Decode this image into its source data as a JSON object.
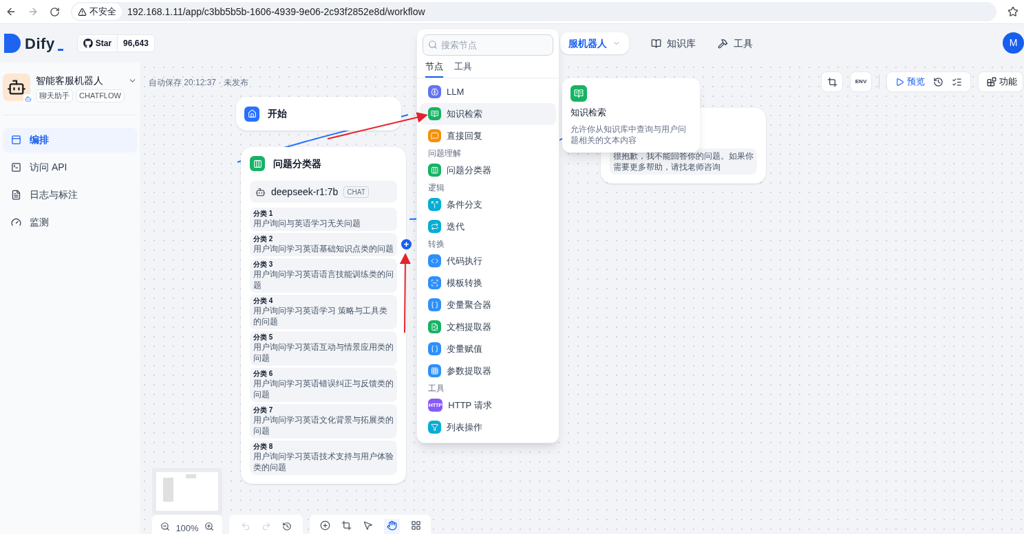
{
  "browser": {
    "security": "不安全",
    "url": "192.168.1.11/app/c3bb5b5b-1606-4939-9e06-2c93f2852e8d/workflow"
  },
  "header": {
    "brand": "Dify",
    "github": "Star",
    "star_count": "96,643",
    "nav": [
      {
        "label": "服机器人",
        "selected": true
      },
      {
        "label": "知识库",
        "selected": false
      },
      {
        "label": "工具",
        "selected": false
      }
    ],
    "avatar": "M"
  },
  "sidebar": {
    "app_name": "智能客服机器人",
    "tags": [
      "聊天助手",
      "CHATFLOW"
    ],
    "items": [
      {
        "label": "编排",
        "selected": true
      },
      {
        "label": "访问 API",
        "selected": false
      },
      {
        "label": "日志与标注",
        "selected": false
      },
      {
        "label": "监测",
        "selected": false
      }
    ]
  },
  "canvas": {
    "autosave": "自动保存 20:12:37 · 未发布",
    "start_node": {
      "title": "开始"
    },
    "classifier_node": {
      "title": "问题分类器",
      "model": "deepseek-r1:7b",
      "model_tag": "CHAT",
      "classes": [
        {
          "label": "分类 1",
          "text": "用户询问与英语学习无关问题"
        },
        {
          "label": "分类 2",
          "text": "用户询问学习英语基础知识点类的问题"
        },
        {
          "label": "分类 3",
          "text": "用户询问学习英语语言技能训练类的问题"
        },
        {
          "label": "分类 4",
          "text": "用户询问学习英语学习 策略与工具类的问题"
        },
        {
          "label": "分类 5",
          "text": "用户询问学习英语互动与情景应用类的问题"
        },
        {
          "label": "分类 6",
          "text": "用户询问学习英语错误纠正与反馈类的问题"
        },
        {
          "label": "分类 7",
          "text": "用户询问学习英语文化背景与拓展类的问题"
        },
        {
          "label": "分类 8",
          "text": "用户询问学习英语技术支持与用户体验类的问题"
        }
      ]
    },
    "answer_node": {
      "text": "很抱歉，我不能回答你的问题。如果你需要更多帮助，请找老师咨询"
    },
    "toolbar": {
      "env": "ENV",
      "preview": "预览",
      "features": "功能"
    },
    "zoom": "100%"
  },
  "node_picker": {
    "placeholder": "搜索节点",
    "tabs": [
      {
        "label": "节点",
        "selected": true
      },
      {
        "label": "工具",
        "selected": false
      }
    ],
    "entries": [
      {
        "kind": "llm",
        "label": "LLM",
        "color": "#6172f3",
        "selected": false
      },
      {
        "kind": "knowledge",
        "label": "知识检索",
        "color": "#16b364",
        "selected": true
      },
      {
        "kind": "answer",
        "label": "直接回复",
        "color": "#f79009",
        "selected": false
      },
      {
        "kind": "group",
        "label": "问题理解"
      },
      {
        "kind": "classifier",
        "label": "问题分类器",
        "color": "#16b364",
        "selected": false
      },
      {
        "kind": "group",
        "label": "逻辑"
      },
      {
        "kind": "branch",
        "label": "条件分支",
        "color": "#06aed4",
        "selected": false
      },
      {
        "kind": "loop",
        "label": "迭代",
        "color": "#06aed4",
        "selected": false
      },
      {
        "kind": "group",
        "label": "转换"
      },
      {
        "kind": "code",
        "label": "代码执行",
        "color": "#2e90fa",
        "selected": false
      },
      {
        "kind": "template",
        "label": "模板转换",
        "color": "#2e90fa",
        "selected": false
      },
      {
        "kind": "aggregator",
        "label": "变量聚合器",
        "color": "#2e90fa",
        "selected": false
      },
      {
        "kind": "doc",
        "label": "文档提取器",
        "color": "#16b364",
        "selected": false
      },
      {
        "kind": "assign",
        "label": "变量赋值",
        "color": "#2e90fa",
        "selected": false
      },
      {
        "kind": "params",
        "label": "参数提取器",
        "color": "#2e90fa",
        "selected": false
      },
      {
        "kind": "group",
        "label": "工具"
      },
      {
        "kind": "http",
        "label": "HTTP 请求",
        "icon_text": "HTTP",
        "color": "#875bf7",
        "selected": false
      },
      {
        "kind": "list",
        "label": "列表操作",
        "color": "#06aed4",
        "selected": false
      }
    ]
  },
  "tooltip": {
    "title": "知识检索",
    "description": "允许你从知识库中查询与用户问题相关的文本内容"
  }
}
